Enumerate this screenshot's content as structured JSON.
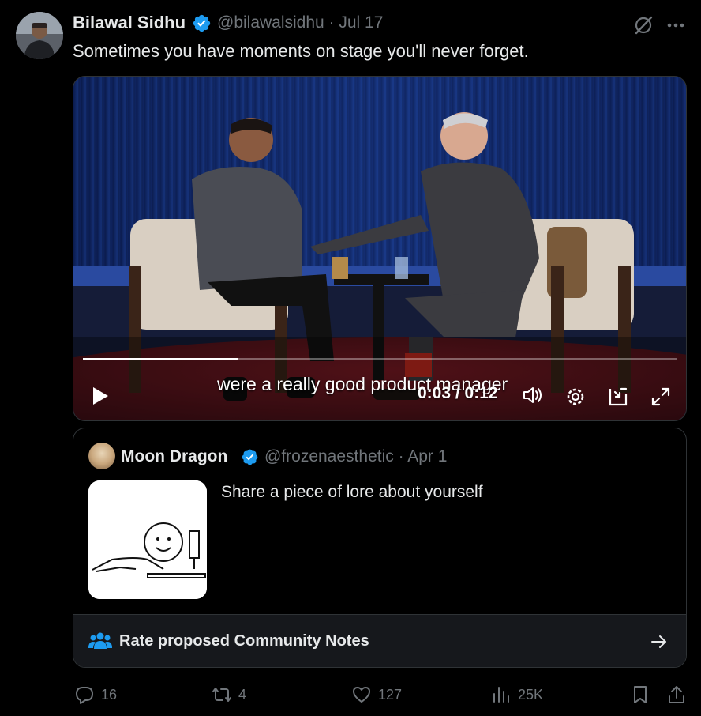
{
  "tweet": {
    "author_name": "Bilawal Sidhu",
    "handle_date": "@bilawalsidhu · Jul 17",
    "text": "Sometimes you have moments on stage you'll never forget."
  },
  "video": {
    "caption": "were a really good product manager",
    "time": "0:03 / 0:12",
    "progress_fraction": 0.26
  },
  "quote": {
    "author_name": "Moon Dragon",
    "handle_date": "@frozenaesthetic · Apr 1",
    "text": "Share a piece of lore about yourself",
    "notes_label": "Rate proposed Community Notes"
  },
  "actions": {
    "replies": "16",
    "reposts": "4",
    "likes": "127",
    "views": "25K"
  },
  "colors": {
    "verified": "#1d9bf0",
    "muted": "#71767b",
    "text": "#e7e9ea",
    "notes_icon": "#1d9bf0"
  },
  "icons": [
    "verified-badge-icon",
    "grok-icon",
    "more-icon",
    "play-icon",
    "volume-icon",
    "settings-icon",
    "pip-icon",
    "fullscreen-icon",
    "people-icon",
    "arrow-right-icon",
    "reply-icon",
    "repost-icon",
    "like-icon",
    "views-icon",
    "bookmark-icon",
    "share-icon"
  ]
}
